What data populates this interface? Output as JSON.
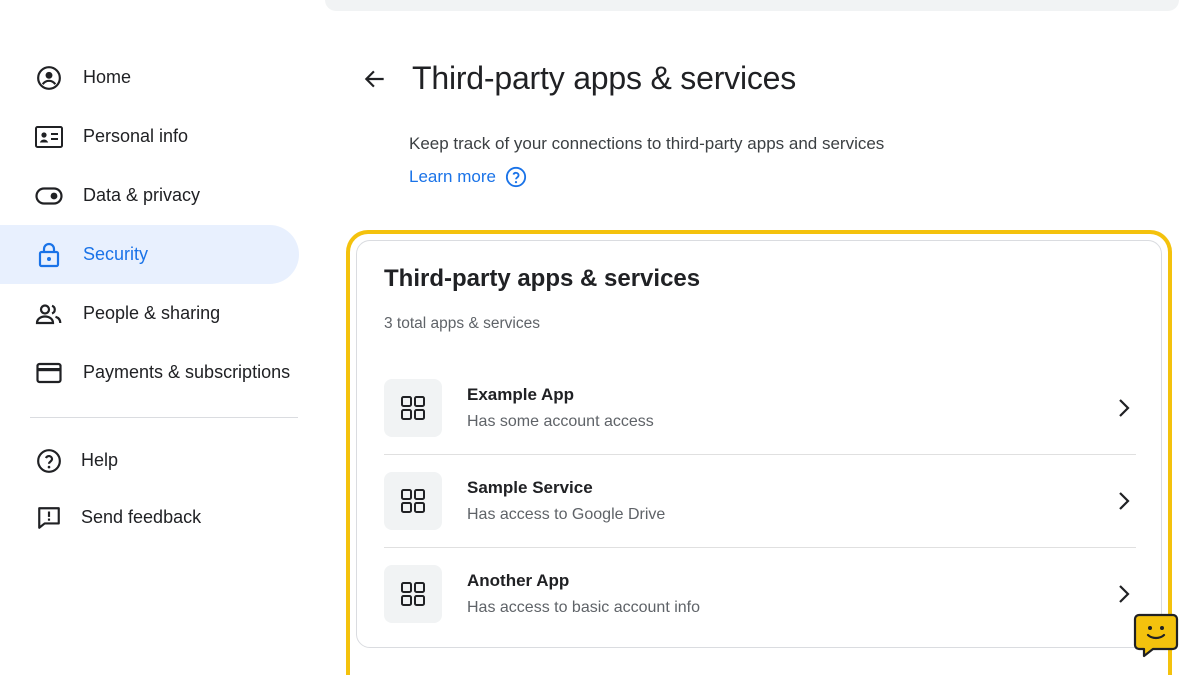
{
  "sidebar": {
    "items": [
      {
        "label": "Home",
        "icon": "account-circle-icon"
      },
      {
        "label": "Personal info",
        "icon": "id-card-icon"
      },
      {
        "label": "Data & privacy",
        "icon": "toggle-icon"
      },
      {
        "label": "Security",
        "icon": "lock-icon",
        "active": true
      },
      {
        "label": "People & sharing",
        "icon": "people-icon"
      },
      {
        "label": "Payments & subscriptions",
        "icon": "credit-card-icon"
      }
    ],
    "footer_items": [
      {
        "label": "Help",
        "icon": "help-icon"
      },
      {
        "label": "Send feedback",
        "icon": "feedback-icon"
      }
    ]
  },
  "header": {
    "title": "Third-party apps & services",
    "subtitle": "Keep track of your connections to third-party apps and services",
    "learn_more": "Learn more"
  },
  "card": {
    "title": "Third-party apps & services",
    "count": "3 total apps & services",
    "apps": [
      {
        "name": "Example App",
        "access": "Has some account access"
      },
      {
        "name": "Sample Service",
        "access": "Has access to Google Drive"
      },
      {
        "name": "Another App",
        "access": "Has access to basic account info"
      }
    ]
  },
  "colors": {
    "accent": "#1a73e8",
    "active_bg": "#e8f0fe",
    "highlight": "#f4c20d",
    "chat_widget": "#f4c20d"
  }
}
